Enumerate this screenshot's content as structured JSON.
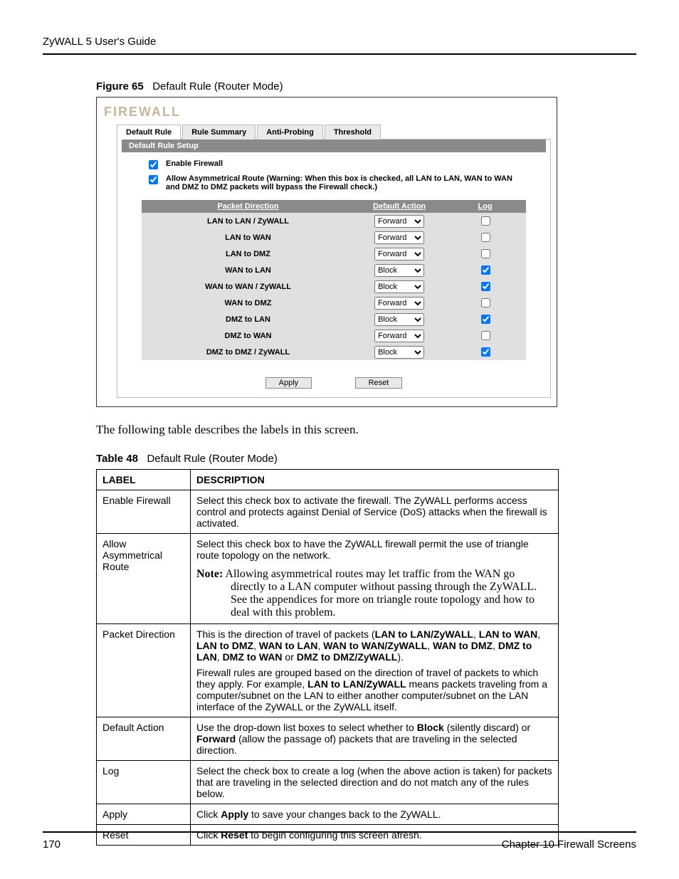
{
  "header": {
    "running_title": "ZyWALL 5 User's Guide"
  },
  "figure": {
    "label": "Figure 65",
    "title": "Default Rule (Router Mode)"
  },
  "firewall_screen": {
    "title": "FIREWALL",
    "tabs": [
      {
        "label": "Default Rule",
        "active": true
      },
      {
        "label": "Rule Summary",
        "active": false
      },
      {
        "label": "Anti-Probing",
        "active": false
      },
      {
        "label": "Threshold",
        "active": false
      }
    ],
    "group_title": "Default Rule Setup",
    "enable_firewall": {
      "label": "Enable Firewall",
      "checked": true
    },
    "allow_asym": {
      "label": "Allow Asymmetrical Route (Warning: When this box is checked, all LAN to LAN, WAN to WAN and DMZ to DMZ packets will bypass the Firewall check.)",
      "checked": true
    },
    "columns": {
      "dir": "Packet Direction",
      "action": "Default Action",
      "log": "Log"
    },
    "action_options": [
      "Forward",
      "Block"
    ],
    "rows": [
      {
        "dir": "LAN to LAN / ZyWALL",
        "action": "Forward",
        "log": false
      },
      {
        "dir": "LAN to WAN",
        "action": "Forward",
        "log": false
      },
      {
        "dir": "LAN to DMZ",
        "action": "Forward",
        "log": false
      },
      {
        "dir": "WAN to LAN",
        "action": "Block",
        "log": true
      },
      {
        "dir": "WAN to WAN / ZyWALL",
        "action": "Block",
        "log": true
      },
      {
        "dir": "WAN to DMZ",
        "action": "Forward",
        "log": false
      },
      {
        "dir": "DMZ to LAN",
        "action": "Block",
        "log": true
      },
      {
        "dir": "DMZ to WAN",
        "action": "Forward",
        "log": false
      },
      {
        "dir": "DMZ to DMZ / ZyWALL",
        "action": "Block",
        "log": true
      }
    ],
    "buttons": {
      "apply": "Apply",
      "reset": "Reset"
    }
  },
  "intro_para": "The following table describes the labels in this screen.",
  "table": {
    "label": "Table 48",
    "title": "Default Rule (Router Mode)",
    "head": {
      "c1": "LABEL",
      "c2": "DESCRIPTION"
    },
    "rows": {
      "enable_firewall": {
        "label": "Enable Firewall",
        "desc": "Select this check box to activate the firewall. The ZyWALL performs access control and protects against Denial of Service (DoS) attacks when the firewall is activated."
      },
      "allow_asym": {
        "label": "Allow Asymmetrical Route",
        "desc": "Select this check box to have the ZyWALL firewall permit the use of triangle route topology on the network.",
        "note_lead": "Note:",
        "note_body": " Allowing asymmetrical routes may let traffic from the WAN go directly to a LAN computer without passing through the ZyWALL. See the appendices for more on triangle route topology and how to deal with this problem."
      },
      "packet_direction": {
        "label": "Packet Direction",
        "p1_a": "This is the direction of travel of packets (",
        "p1_b1": "LAN to LAN/ZyWALL",
        "p1_s1": ", ",
        "p1_b2": "LAN to WAN",
        "p1_s2": ", ",
        "p1_b3": "LAN to DMZ",
        "p1_s3": ", ",
        "p1_b4": "WAN to LAN",
        "p1_s4": ", ",
        "p1_b5": "WAN to WAN/ZyWALL",
        "p1_s5": ", ",
        "p1_b6": "WAN to DMZ",
        "p1_s6": ", ",
        "p1_b7": "DMZ to LAN",
        "p1_s7": ", ",
        "p1_b8": "DMZ to WAN",
        "p1_s8": " or ",
        "p1_b9": "DMZ to DMZ/ZyWALL",
        "p1_c": ").",
        "p2_a": "Firewall rules are grouped based on the direction of travel of packets to which they apply. For example, ",
        "p2_b": "LAN to LAN/ZyWALL",
        "p2_c": " means packets traveling from a computer/subnet on the LAN to either another computer/subnet on the LAN interface of the ZyWALL or the ZyWALL itself."
      },
      "default_action": {
        "label": "Default Action",
        "a": "Use the drop-down list boxes to select whether to ",
        "b1": "Block",
        "m": " (silently discard) or ",
        "b2": "Forward",
        "c": " (allow the passage of) packets that are traveling in the selected direction."
      },
      "log": {
        "label": "Log",
        "desc": "Select the check box to create a log (when the above action is taken) for packets that are traveling in the selected direction and do not match any of the rules below."
      },
      "apply": {
        "label": "Apply",
        "a": "Click ",
        "b": "Apply",
        "c": " to save your changes back to the ZyWALL."
      },
      "reset": {
        "label": "Reset",
        "a": "Click ",
        "b": "Reset",
        "c": " to begin configuring this screen afresh."
      }
    }
  },
  "footer": {
    "page": "170",
    "chapter": "Chapter 10 Firewall Screens"
  }
}
